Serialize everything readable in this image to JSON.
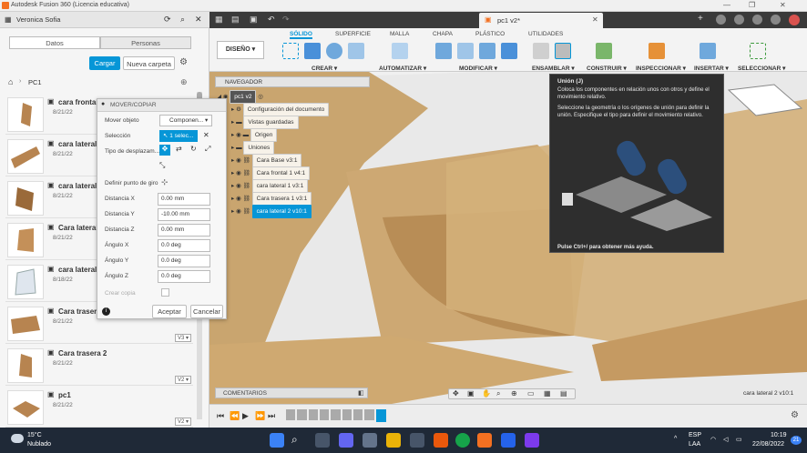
{
  "window": {
    "title": "Autodesk Fusion 360 (Licencia educativa)"
  },
  "datapanel": {
    "user": "Veronica Sofia",
    "tabs": [
      "Datos",
      "Personas"
    ],
    "upload_label": "Cargar",
    "new_folder_label": "Nueva carpeta",
    "breadcrumb": "PC1",
    "files": [
      {
        "name": "cara frontal",
        "date": "8/21/22",
        "version": ""
      },
      {
        "name": "cara lateral",
        "date": "8/21/22",
        "version": ""
      },
      {
        "name": "cara lateral",
        "date": "8/21/22",
        "version": ""
      },
      {
        "name": "Cara lateral",
        "date": "8/21/22",
        "version": ""
      },
      {
        "name": "cara lateral",
        "date": "8/18/22",
        "version": ""
      },
      {
        "name": "Cara trasera",
        "date": "8/21/22",
        "version": "V3"
      },
      {
        "name": "Cara trasera 2",
        "date": "8/21/22",
        "version": "V2"
      },
      {
        "name": "pc1",
        "date": "8/21/22",
        "version": "V2"
      }
    ]
  },
  "toolbar": {
    "doc_tab": "pc1 v2*"
  },
  "ribbon": {
    "workspace": "DISEÑO",
    "tabs": [
      "SÓLIDO",
      "SUPERFICIE",
      "MALLA",
      "CHAPA",
      "PLÁSTICO",
      "UTILIDADES"
    ],
    "groups": [
      "CREAR",
      "AUTOMATIZAR",
      "MODIFICAR",
      "ENSAMBLAR",
      "CONSTRUIR",
      "INSPECCIONAR",
      "INSERTAR",
      "SELECCIONAR"
    ]
  },
  "navigator": {
    "title": "NAVEGADOR",
    "root": "pc1 v2",
    "items": [
      "Configuración del documento",
      "Vistas guardadas",
      "Origen",
      "Uniones",
      "Cara Base v3:1",
      "Cara frontal 1 v4:1",
      "cara lateral 1 v3:1",
      "Cara trasera 1 v3:1",
      "cara lateral 2 v10:1"
    ]
  },
  "movepanel": {
    "title": "MOVER/COPIAR",
    "rows": [
      {
        "label": "Mover objeto",
        "value": "Componen..."
      },
      {
        "label": "Selección",
        "value": "1 selec..."
      },
      {
        "label": "Tipo de desplazam...",
        "value": ""
      },
      {
        "label": "Definir punto de giro",
        "value": ""
      },
      {
        "label": "Distancia X",
        "value": "0.00 mm"
      },
      {
        "label": "Distancia Y",
        "value": "-10.00 mm"
      },
      {
        "label": "Distancia Z",
        "value": "0.00 mm"
      },
      {
        "label": "Ángulo X",
        "value": "0.0 deg"
      },
      {
        "label": "Ángulo Y",
        "value": "0.0 deg"
      },
      {
        "label": "Ángulo Z",
        "value": "0.0 deg"
      },
      {
        "label": "Crear copia",
        "value": ""
      }
    ],
    "ok": "Aceptar",
    "cancel": "Cancelar"
  },
  "tooltip": {
    "title": "Unión (J)",
    "p1": "Coloca los componentes en relación unos con otros y define el movimiento relativo.",
    "p2": "Seleccione la geometría o los orígenes de unión para definir la unión. Especifique el tipo para definir el movimiento relativo.",
    "footer": "Pulse Ctrl+/ para obtener más ayuda."
  },
  "status": {
    "comments": "COMENTARIOS",
    "selection": "cara lateral 2 v10:1"
  },
  "taskbar": {
    "weather_temp": "15°C",
    "weather_desc": "Nublado",
    "lang": "ESP",
    "lang2": "LAA",
    "time": "10:19",
    "date": "22/08/2022",
    "notif": "21"
  },
  "colors": {
    "accent": "#0696d7",
    "wood": "#c9a56f",
    "taskbar": "#1f2937"
  }
}
